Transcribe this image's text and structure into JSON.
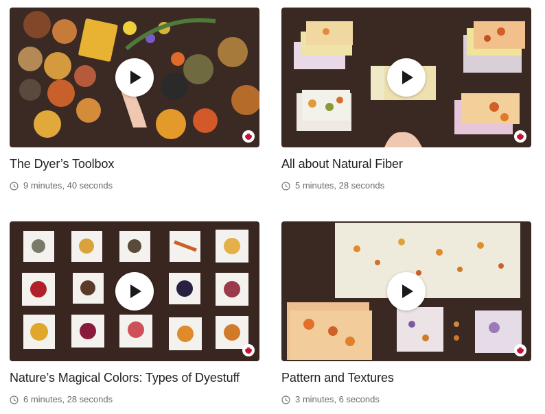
{
  "videos": [
    {
      "title": "The Dyer’s Toolbox",
      "duration": "9 minutes, 40 seconds"
    },
    {
      "title": "All about Natural Fiber",
      "duration": "5 minutes, 28 seconds"
    },
    {
      "title": "Nature’s Magical Colors: Types of Dyestuff",
      "duration": "6 minutes, 28 seconds"
    },
    {
      "title": "Pattern and Textures",
      "duration": "3 minutes, 6 seconds"
    }
  ],
  "icons": {
    "play": "play-icon",
    "duration": "clock-icon",
    "brand": "brand-badge-icon"
  },
  "colors": {
    "brand": "#c8102e",
    "title_text": "#1f1f1f",
    "meta_text": "#6b6b6b",
    "table_wood": "#3a2822"
  }
}
